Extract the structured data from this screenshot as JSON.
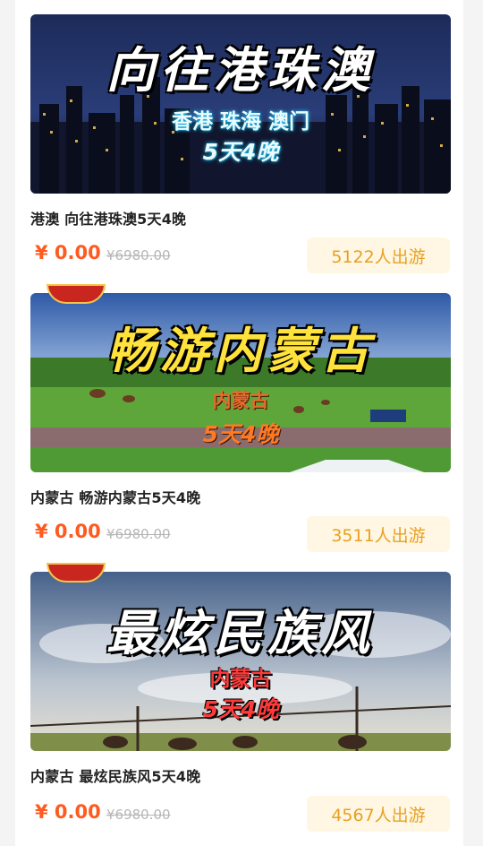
{
  "tours": [
    {
      "banner_title": "向往港珠澳",
      "banner_line1": "香港 珠海 澳门",
      "banner_line2": "5天4晚",
      "name": "港澳 向往港珠澳5天4晚",
      "price": "¥ 0.00",
      "original_price": "¥6980.00",
      "travelers": "5122人出游"
    },
    {
      "banner_title": "畅游内蒙古",
      "banner_line1": "内蒙古",
      "banner_line2": "5天4晚",
      "name": "内蒙古 畅游内蒙古5天4晚",
      "price": "¥ 0.00",
      "original_price": "¥6980.00",
      "travelers": "3511人出游"
    },
    {
      "banner_title": "最炫民族风",
      "banner_line1": "内蒙古",
      "banner_line2": "5天4晚",
      "name": "内蒙古 最炫民族风5天4晚",
      "price": "¥ 0.00",
      "original_price": "¥6980.00",
      "travelers": "4567人出游"
    }
  ],
  "colors": {
    "price": "#ff5a1f",
    "badge_bg": "#fff7e3",
    "badge_text": "#e9a021"
  }
}
